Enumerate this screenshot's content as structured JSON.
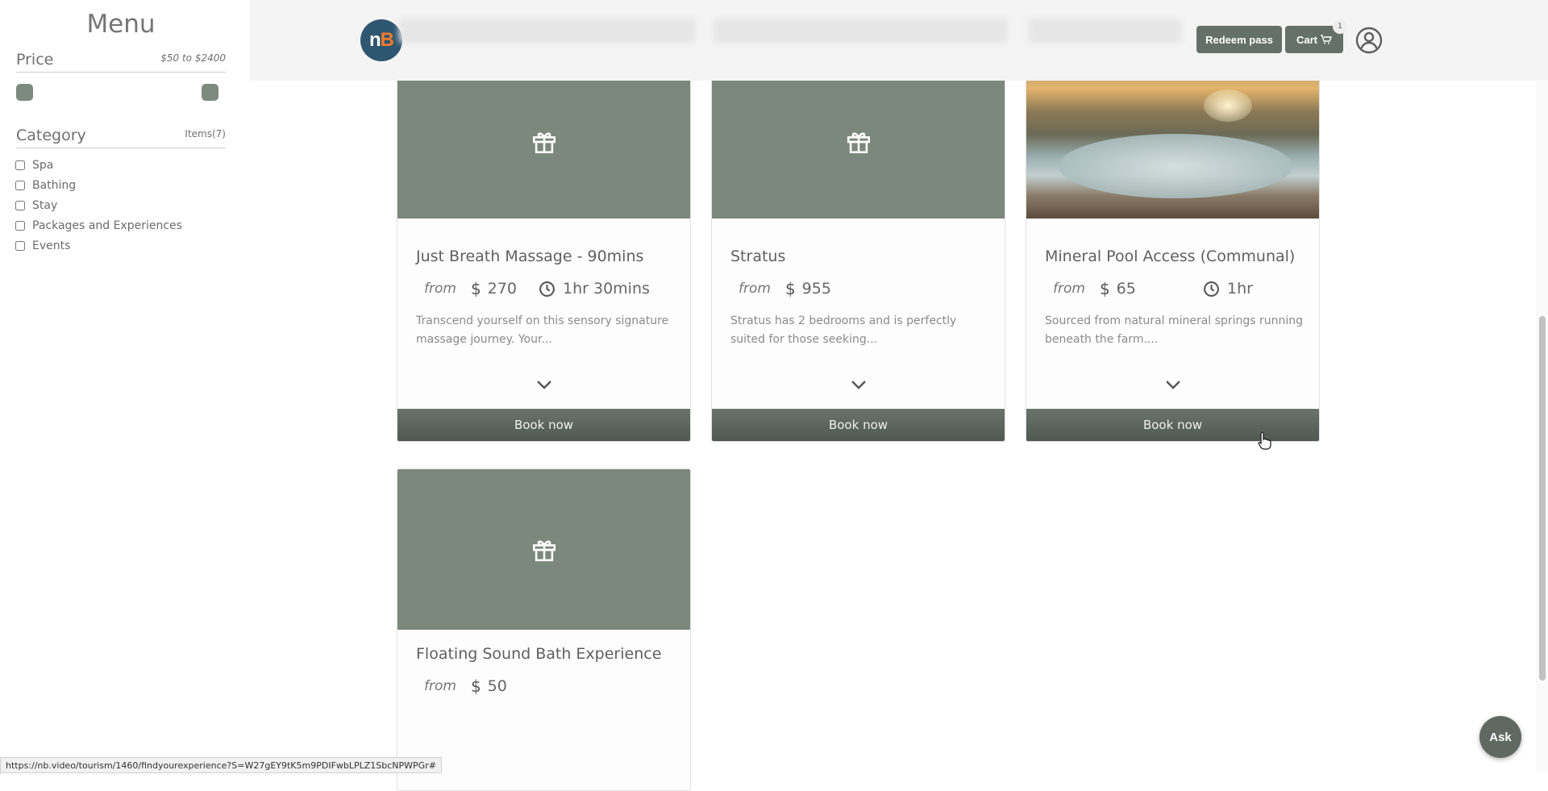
{
  "sidebar": {
    "menu_title": "Menu",
    "price": {
      "label": "Price",
      "range_text": "$50 to $2400",
      "min_fraction": 0.0,
      "max_fraction": 1.0
    },
    "category": {
      "label": "Category",
      "count_text": "Items(7)",
      "items": [
        {
          "label": "Spa",
          "checked": false
        },
        {
          "label": "Bathing",
          "checked": false
        },
        {
          "label": "Stay",
          "checked": false
        },
        {
          "label": "Packages and Experiences",
          "checked": false
        },
        {
          "label": "Events",
          "checked": false
        }
      ]
    }
  },
  "header": {
    "logo_text_n": "n",
    "logo_text_b": "B",
    "redeem_label": "Redeem pass",
    "cart_label": "Cart",
    "cart_count": "1"
  },
  "cards": [
    {
      "title": "Just Breath Massage - 90mins",
      "from_label": "from",
      "price": "270",
      "duration": "1hr 30mins",
      "description": "Transcend yourself on this sensory signature massage journey. Your...",
      "book_label": "Book now",
      "media": "gift-icon"
    },
    {
      "title": "Stratus",
      "from_label": "from",
      "price": "955",
      "duration": "",
      "description": "Stratus has 2 bedrooms and is perfectly suited for those seeking...",
      "book_label": "Book now",
      "media": "gift-icon"
    },
    {
      "title": "Mineral Pool Access (Communal)",
      "from_label": "from",
      "price": "65",
      "duration": "1hr",
      "description": "Sourced from natural mineral springs running beneath the farm....",
      "book_label": "Book now",
      "media": "photo"
    },
    {
      "title": "Floating Sound Bath Experience",
      "from_label": "from",
      "price": "50",
      "duration": "",
      "description": "",
      "book_label": "",
      "media": "gift-icon"
    }
  ],
  "status_url": "https://nb.video/tourism/1460/findyourexperience?S=W27gEY9tK5m9PDIFwbLPLZ1SbcNPWPGr#",
  "ask_label": "Ask",
  "colors": {
    "accent": "#7d887c",
    "button": "#66706a",
    "brand_blue": "#2f5670",
    "brand_orange": "#f27b2a"
  }
}
